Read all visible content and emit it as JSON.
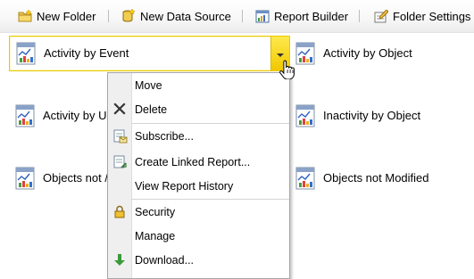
{
  "toolbar": {
    "new_folder": {
      "label": "New Folder",
      "icon": "folder-new-icon"
    },
    "new_data_source": {
      "label": "New Data Source",
      "icon": "data-source-icon"
    },
    "report_builder": {
      "label": "Report Builder",
      "icon": "report-builder-icon"
    },
    "folder_settings": {
      "label": "Folder Settings",
      "icon": "folder-settings-icon"
    }
  },
  "reports": [
    {
      "label": "Activity by Event",
      "selected": true
    },
    {
      "label": "Activity by Object"
    },
    {
      "label": "Activity by U"
    },
    {
      "label": "Inactivity by Object"
    },
    {
      "label": "Objects not /"
    },
    {
      "label": "Objects not Modified"
    }
  ],
  "context_menu": {
    "items": [
      {
        "label": "Move",
        "icon": ""
      },
      {
        "label": "Delete",
        "icon": "delete-x-icon"
      },
      {
        "label": "Subscribe...",
        "icon": "subscribe-icon"
      },
      {
        "label": "Create Linked Report...",
        "icon": "linked-report-icon"
      },
      {
        "label": "View Report History",
        "icon": ""
      },
      {
        "label": "Security",
        "icon": "lock-icon"
      },
      {
        "label": "Manage",
        "icon": ""
      },
      {
        "label": "Download...",
        "icon": "download-arrow-icon"
      }
    ]
  },
  "colors": {
    "selection_border": "#e8c800",
    "dropdown_arrow": "#f0c800",
    "menu_gutter": "#efefef"
  }
}
